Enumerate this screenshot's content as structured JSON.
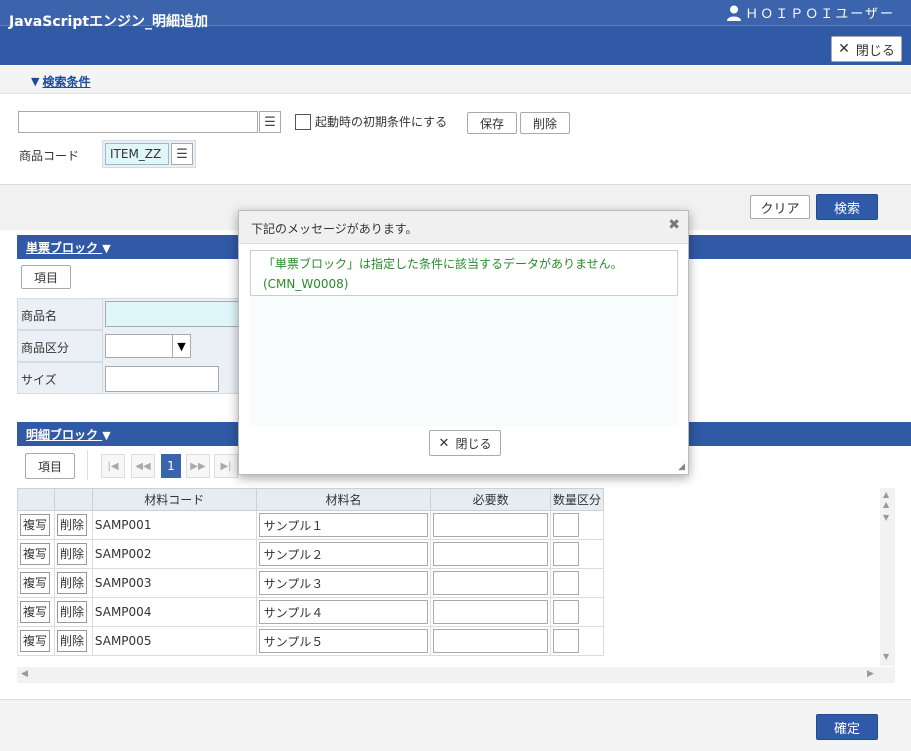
{
  "header": {
    "user": "ＨＯＩＰＯＩユーザー",
    "title": "JavaScriptエンジン_明細追加",
    "close_label": "閉じる"
  },
  "search": {
    "toggle_label": "検索条件",
    "preset_placeholder": "",
    "initial_checkbox_label": "起動時の初期条件にする",
    "save_label": "保存",
    "delete_label": "削除",
    "product_code_label": "商品コード",
    "product_code_value": "ITEM_ZZ",
    "clear_label": "クリア",
    "search_label": "検索"
  },
  "slip_block": {
    "title": "単票ブロック",
    "items_button": "項目",
    "fields": {
      "product_name": "商品名",
      "product_category": "商品区分",
      "size": "サイズ"
    }
  },
  "detail_block": {
    "title": "明細ブロック",
    "items_button": "項目",
    "pager": {
      "current_page": "1"
    },
    "columns": [
      "材料コード",
      "材料名",
      "必要数",
      "数量区分"
    ],
    "copy_label": "複写",
    "delete_label": "削除",
    "rows": [
      {
        "code": "SAMP001",
        "name": "サンプル１",
        "qty": "",
        "unit": ""
      },
      {
        "code": "SAMP002",
        "name": "サンプル２",
        "qty": "",
        "unit": ""
      },
      {
        "code": "SAMP003",
        "name": "サンプル３",
        "qty": "",
        "unit": ""
      },
      {
        "code": "SAMP004",
        "name": "サンプル４",
        "qty": "",
        "unit": ""
      },
      {
        "code": "SAMP005",
        "name": "サンプル５",
        "qty": "",
        "unit": ""
      }
    ]
  },
  "modal": {
    "title": "下記のメッセージがあります。",
    "message_line1": "「単票ブロック」は指定した条件に該当するデータがありません。",
    "message_line2": "(CMN_W0008)",
    "close_label": "閉じる",
    "message_color": "#2a8a2a"
  },
  "footer": {
    "confirm_label": "確定"
  }
}
